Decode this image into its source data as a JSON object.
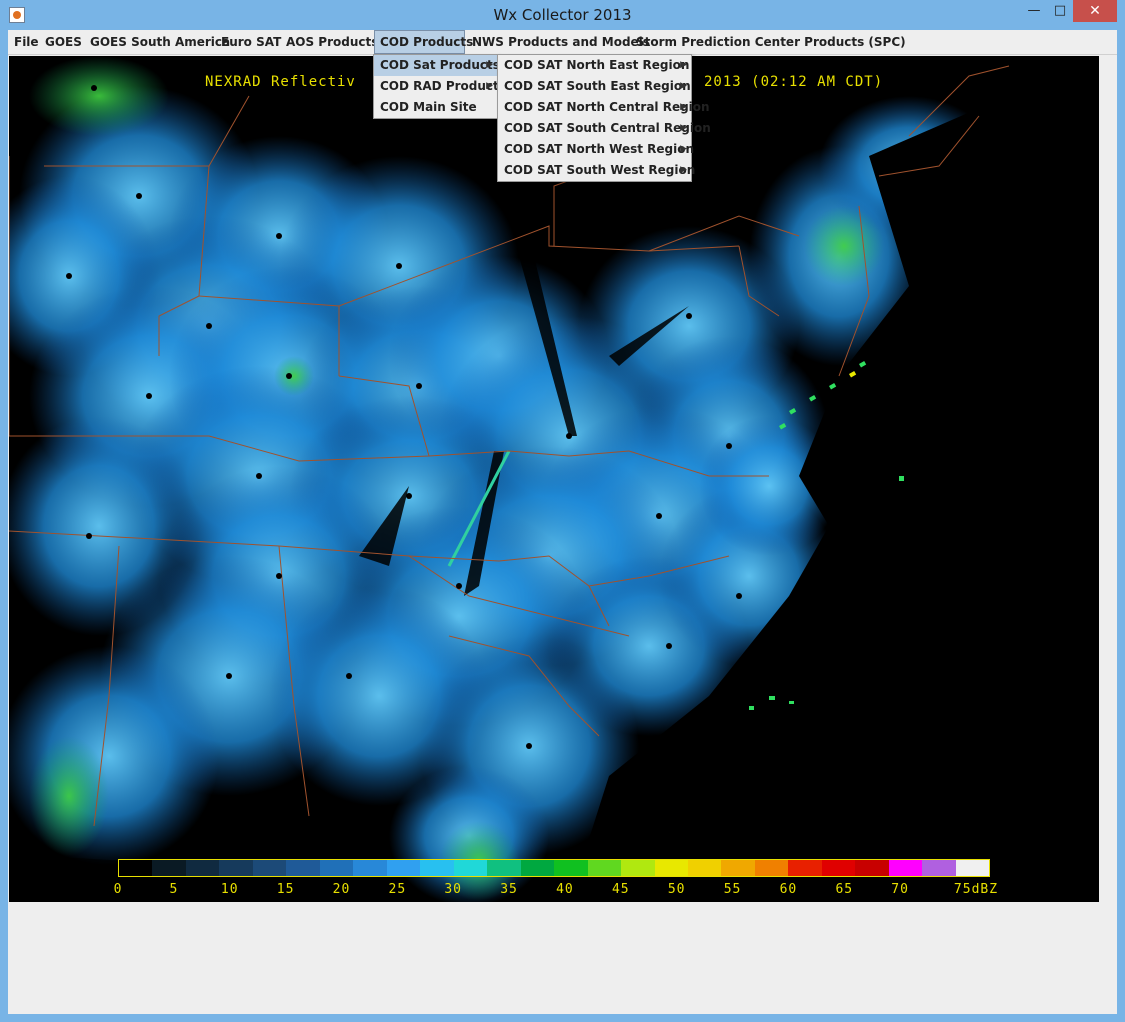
{
  "window": {
    "title": "Wx Collector 2013",
    "controls": {
      "minimize": "—",
      "maximize": "□",
      "close": "✕"
    }
  },
  "menubar": {
    "items": [
      {
        "label": "File"
      },
      {
        "label": "GOES"
      },
      {
        "label": "GOES South America"
      },
      {
        "label": "Euro SAT"
      },
      {
        "label": "AOS Products"
      },
      {
        "label": "COD Products"
      },
      {
        "label": "NWS Products and Models"
      },
      {
        "label": "Storm Prediction Center Products (SPC)"
      }
    ],
    "active": "COD Products"
  },
  "cod_menu": {
    "items": [
      {
        "label": "COD Sat Products",
        "has_submenu": true
      },
      {
        "label": "COD RAD Products",
        "has_submenu": true
      },
      {
        "label": "COD Main Site",
        "has_submenu": false
      }
    ],
    "highlighted": "COD Sat Products"
  },
  "cod_sat_submenu": {
    "items": [
      {
        "label": "COD SAT North East Region"
      },
      {
        "label": "COD SAT South East Region"
      },
      {
        "label": "COD SAT North Central Region"
      },
      {
        "label": "COD SAT South Central Region"
      },
      {
        "label": "COD SAT North West Region"
      },
      {
        "label": "COD SAT South West Region"
      }
    ]
  },
  "map": {
    "title_left": "NEXRAD Reflectiv",
    "title_right": "2013 (02:12 AM CDT)",
    "colors": {
      "background": "#000000",
      "label": "#e8e000",
      "borders": "#a0522d"
    },
    "scale": {
      "unit": "dBZ",
      "labels": [
        "0",
        "5",
        "10",
        "15",
        "20",
        "25",
        "30",
        "35",
        "40",
        "45",
        "50",
        "55",
        "60",
        "65",
        "70",
        "75dBZ"
      ],
      "colors": [
        "#000000",
        "#0a1a24",
        "#102a40",
        "#163a5c",
        "#1c4a78",
        "#1f5a98",
        "#2070b8",
        "#2888d8",
        "#30a0f0",
        "#28c0f0",
        "#20d8d8",
        "#10c080",
        "#00a840",
        "#10c020",
        "#60d820",
        "#b0e810",
        "#e8e800",
        "#f0d000",
        "#f0a800",
        "#f08000",
        "#e82000",
        "#e00000",
        "#c80000",
        "#ff00ff",
        "#b060e0",
        "#f0f0f0"
      ]
    }
  }
}
